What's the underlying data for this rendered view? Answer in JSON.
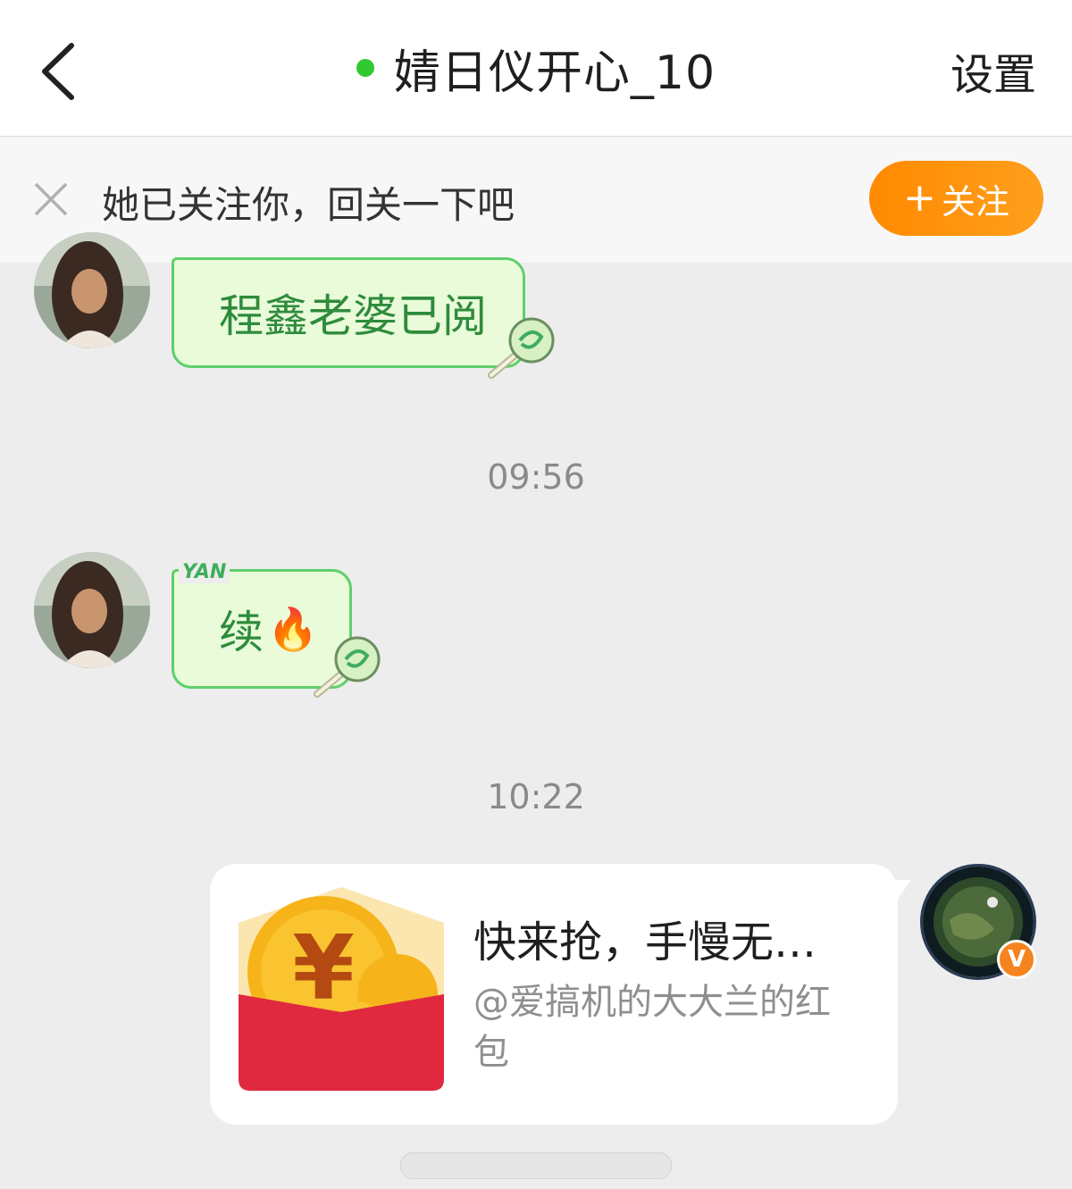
{
  "header": {
    "title": "婧日仪开心_10",
    "settings_label": "设置",
    "online_color": "#32c832"
  },
  "follow_banner": {
    "text": "她已关注你，回关一下吧",
    "button_label": "关注",
    "button_icon": "plus-icon",
    "close_icon": "close-icon"
  },
  "messages": [
    {
      "sender": "contact",
      "text": "程鑫老婆已阅",
      "decoration": "lollipop-icon"
    },
    {
      "type": "timestamp",
      "text": "09:56"
    },
    {
      "sender": "contact",
      "text": "续",
      "emoji": "🔥",
      "badge": "YAN",
      "decoration": "lollipop-icon"
    },
    {
      "type": "timestamp",
      "text": "10:22"
    },
    {
      "sender": "me",
      "type": "red-packet",
      "title": "快来抢，手慢无…",
      "subtitle": "@爱搞机的大大兰的红包",
      "verified_badge": "V"
    }
  ],
  "colors": {
    "bubble_bg": "#e9fbd9",
    "bubble_border": "#5fcf6a",
    "bubble_text": "#2e8b3c",
    "follow_button": "#ff8a00",
    "red_packet": "#e0293f"
  }
}
